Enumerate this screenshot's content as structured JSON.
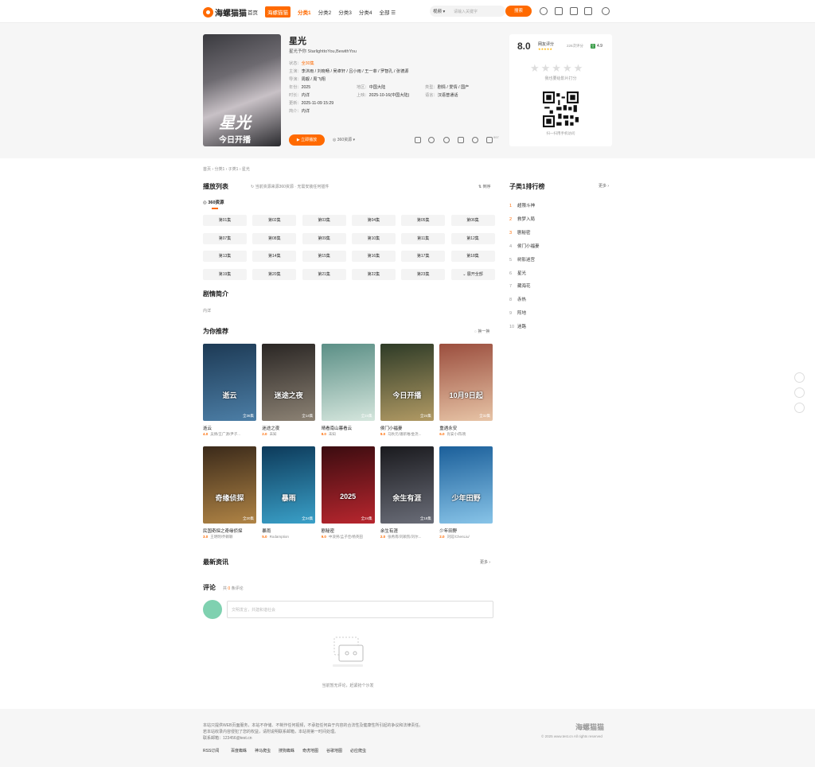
{
  "header": {
    "logo": "海螺猫猫",
    "nav": [
      {
        "label": "首页"
      },
      {
        "label": "海螺猫猫"
      },
      {
        "label": "分类1"
      },
      {
        "label": "分类2"
      },
      {
        "label": "分类3"
      },
      {
        "label": "分类4"
      },
      {
        "label": "全部 ☰"
      }
    ],
    "search_type": "视频 ▾",
    "search_placeholder": "请输入关键字",
    "search_button": "搜索"
  },
  "movie": {
    "title": "星光",
    "subtitle": "星光予你 StarlighttoYou,BewithYou",
    "poster_title": "星光",
    "poster_sub": "今日开播",
    "status_k": "状态：",
    "status_v": "全30集",
    "cast_k": "主演：",
    "cast_v": "李沐雨 / 刘晓畅 / 吴卓轩 / 吕小雨 / 王一菲 / 罗智孔 / 张德源",
    "director_k": "导演：",
    "director_v": "周靓 / 周飞翔",
    "year_k": "年份：",
    "year_v": "2025",
    "area_k": "地区：",
    "area_v": "中国大陆",
    "type_k": "类型：",
    "type_v": "剧情 / 爱情 / 国产",
    "dur_k": "时长：",
    "dur_v": "内详",
    "release_k": "上映：",
    "release_v": "2025-10-16(中国大陆)",
    "lang_k": "语言：",
    "lang_v": "汉语普通话",
    "update_k": "更新：",
    "update_v": "2025-11-09 15:29",
    "intro_k": "简介：",
    "intro_v": "内详",
    "play_button": "▶ 立即播放",
    "source_select": "◎ 360资源 ▾",
    "like_count": "997"
  },
  "rating": {
    "score": "8.0",
    "label": "网友评分",
    "stars": "★★★★★",
    "count": "226次评分",
    "douban_badge": "豆",
    "douban_score": "4.9",
    "prompt": "我也要给影片打分",
    "qr_text": "扫一扫用手机访问",
    "big_stars": "★★★★★"
  },
  "breadcrumb": "首页 › 分类1 › 子类1 › 星光",
  "playlist": {
    "title": "播放列表",
    "tip": "↻ 当前资源来源360资源 · 无需安装任何插件",
    "sort": "⇅ 倒序",
    "tab": "◎ 360资源",
    "episodes": [
      "第01集",
      "第02集",
      "第03集",
      "第04集",
      "第05集",
      "第06集",
      "第07集",
      "第08集",
      "第09集",
      "第10集",
      "第11集",
      "第12集",
      "第13集",
      "第14集",
      "第15集",
      "第16集",
      "第17集",
      "第18集",
      "第19集",
      "第20集",
      "第21集",
      "第22集",
      "第23集",
      "⌄ 展开全部"
    ]
  },
  "synopsis": {
    "title": "剧情简介",
    "text": "内详"
  },
  "recommend": {
    "title": "为你推荐",
    "refresh": "◌ 换一换",
    "items": [
      {
        "name": "逝云",
        "score": "4.0",
        "cast": "吴倩/王广源/尹子...",
        "badge": "全36集",
        "poster": "逝云",
        "c1": "#1d3a55",
        "c2": "#4c7ea6"
      },
      {
        "name": "迷途之夜",
        "score": "2.0",
        "cast": "未知",
        "badge": "全14集",
        "poster": "迷途之夜",
        "c1": "#2a2624",
        "c2": "#8c8274"
      },
      {
        "name": "晴看南山暮看云",
        "score": "8.0",
        "cast": "未知",
        "badge": "全24集",
        "poster": "",
        "c1": "#5b8f86",
        "c2": "#d5e6dd"
      },
      {
        "name": "侯门小福妻",
        "score": "9.0",
        "cast": "马秋元/潘新唯/金尧...",
        "badge": "全24集",
        "poster": "今日开播",
        "c1": "#2e3b27",
        "c2": "#b19a64"
      },
      {
        "name": "重遇永安",
        "score": "6.0",
        "cast": "肖安小/陈晓",
        "badge": "全32集",
        "poster": "10月9日起",
        "c1": "#9b4e3e",
        "c2": "#e7c4a6"
      },
      {
        "name": "民国奇探之奇缘侦探",
        "score": "3.0",
        "cast": "王明明/乔颖颖",
        "badge": "全20集",
        "poster": "奇缘侦探",
        "c1": "#3b2a1a",
        "c2": "#b08445"
      },
      {
        "name": "暴雨",
        "score": "5.0",
        "cast": "Rodamption",
        "badge": "全24集",
        "poster": "暴雨",
        "c1": "#0d3a5a",
        "c2": "#3aa0c8"
      },
      {
        "name": "剧秘密",
        "score": "9.0",
        "cast": "中浪男/孟子佳/杨英田",
        "badge": "全24集",
        "poster": "2025",
        "c1": "#3b0c10",
        "c2": "#b8262e"
      },
      {
        "name": "余生有涯",
        "score": "2.0",
        "cast": "张希南/刘颖凯/刘尔...",
        "badge": "全18集",
        "poster": "余生有涯",
        "c1": "#1a1a1e",
        "c2": "#6a6d78"
      },
      {
        "name": "少年田野",
        "score": "2.0",
        "cast": "刘延/ChenLiu/",
        "badge": "",
        "poster": "少年田野",
        "c1": "#1b5f9a",
        "c2": "#88c4e8"
      }
    ]
  },
  "news": {
    "title": "最新资讯",
    "more": "更多 ›"
  },
  "comments": {
    "title": "评论",
    "count_prefix": "共",
    "count": "0",
    "count_suffix": "条评论",
    "placeholder": "文明发言，共建和谐社会",
    "empty": "当前暂无评论，赶紧抢个沙发"
  },
  "ranking": {
    "title": "子类1排行榜",
    "more": "更多 ›",
    "items": [
      "超限斗神",
      "救梦入局",
      "剧秘密",
      "侯门小福妻",
      "树影迷宫",
      "星光",
      "藏海花",
      "赤热",
      "阵地",
      "迷路"
    ]
  },
  "footer": {
    "line1": "本站只提供WEB页面服务，本站不存储、不制作任何视频，不承担任何由于内容的合法性及健康性所引起的争议和法律责任。",
    "line2": "若本站收录内容侵犯了您的权益，请附说明联系邮箱，本站将第一时间处理。",
    "line3": "联系邮箱：123456@test.cn",
    "logo": "海螺猫猫",
    "copyright": "© 2025 www.test.cn All rights reserved",
    "links": [
      "RSS订阅",
      "百度蜘蛛",
      "神马爬虫",
      "搜狗蜘蛛",
      "奇虎地图",
      "谷歌地图",
      "必应爬虫"
    ]
  }
}
